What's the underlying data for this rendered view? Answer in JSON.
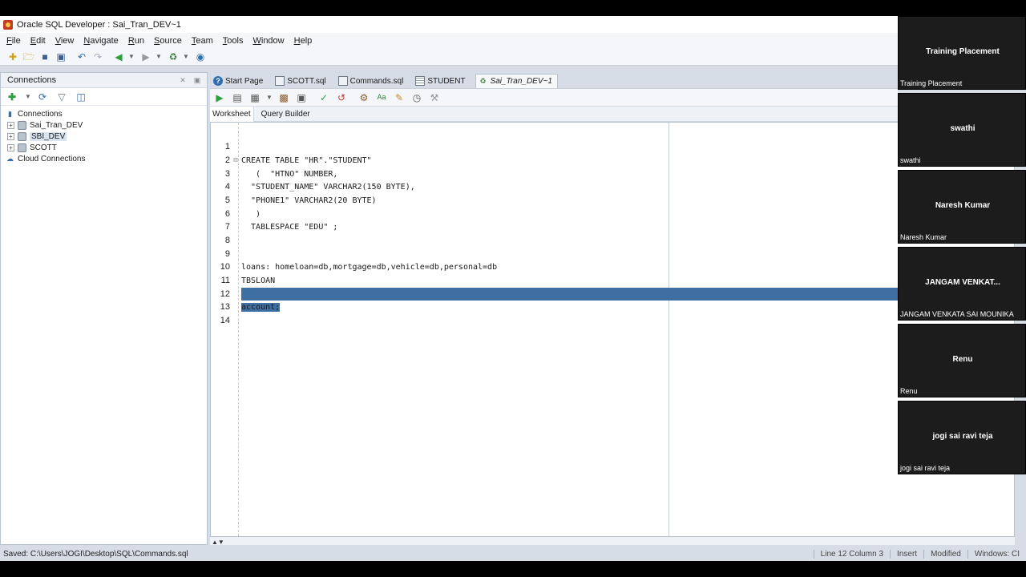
{
  "window": {
    "title": "Oracle SQL Developer : Sai_Tran_DEV~1"
  },
  "menu": [
    "File",
    "Edit",
    "View",
    "Navigate",
    "Run",
    "Source",
    "Team",
    "Tools",
    "Window",
    "Help"
  ],
  "connections_panel": {
    "title": "Connections",
    "tree": [
      {
        "label": "Connections",
        "type": "root"
      },
      {
        "label": "Sai_Tran_DEV",
        "type": "db",
        "expandable": true
      },
      {
        "label": "SBI_DEV",
        "type": "db",
        "expandable": true,
        "selected": true
      },
      {
        "label": "SCOTT",
        "type": "db",
        "expandable": true
      },
      {
        "label": "Cloud Connections",
        "type": "cloud"
      }
    ]
  },
  "tabs": [
    {
      "label": "Start Page",
      "icon": "help-icon"
    },
    {
      "label": "SCOTT.sql",
      "icon": "sql-file-icon"
    },
    {
      "label": "Commands.sql",
      "icon": "sql-file-icon"
    },
    {
      "label": "STUDENT",
      "icon": "table-icon"
    },
    {
      "label": "Sai_Tran_DEV~1",
      "icon": "worksheet-icon",
      "active": true
    }
  ],
  "subtabs": [
    "Worksheet",
    "Query Builder"
  ],
  "editor": {
    "lines": [
      {
        "n": "1",
        "text": ""
      },
      {
        "n": "2",
        "text": "CREATE TABLE \"HR\".\"STUDENT\""
      },
      {
        "n": "3",
        "text": "   (  \"HTNO\" NUMBER,"
      },
      {
        "n": "4",
        "text": "  \"STUDENT_NAME\" VARCHAR2(150 BYTE),"
      },
      {
        "n": "5",
        "text": "  \"PHONE1\" VARCHAR2(20 BYTE)"
      },
      {
        "n": "6",
        "text": "   )"
      },
      {
        "n": "7",
        "text": "  TABLESPACE \"EDU\" ;"
      },
      {
        "n": "8",
        "text": ""
      },
      {
        "n": "9",
        "text": ""
      },
      {
        "n": "10",
        "text": "loans: homeloan=db,mortgage=db,vehicle=db,personal=db"
      },
      {
        "n": "11",
        "text": "TBSLOAN"
      },
      {
        "n": "12",
        "text": ""
      },
      {
        "n": "13",
        "text": "account;"
      },
      {
        "n": "14",
        "text": ""
      }
    ]
  },
  "status": {
    "left": "Saved: C:\\Users\\JOGI\\Desktop\\SQL\\Commands.sql",
    "position": "Line 12 Column 3",
    "mode": "Insert",
    "modified": "Modified",
    "os": "Windows: CI"
  },
  "participants": [
    {
      "name": "Training Placement",
      "label": "Training Placement"
    },
    {
      "name": "swathi",
      "label": "swathi"
    },
    {
      "name": "Naresh Kumar",
      "label": "Naresh Kumar"
    },
    {
      "name": "JANGAM VENKAT...",
      "label": "JANGAM VENKATA SAI MOUNIKA"
    },
    {
      "name": "Renu",
      "label": "Renu"
    },
    {
      "name": "jogi sai ravi teja",
      "label": "jogi sai ravi teja"
    }
  ]
}
